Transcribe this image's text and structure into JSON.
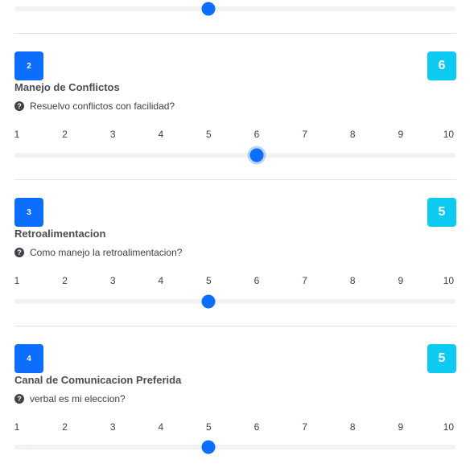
{
  "top_slider": {
    "value": 5
  },
  "questions": [
    {
      "number": "2",
      "value_badge": "6",
      "title": "Manejo de Conflictos",
      "help_text": "Resuelvo conflictos con facilidad?",
      "value": 6
    },
    {
      "number": "3",
      "value_badge": "5",
      "title": "Retroalimentacion",
      "help_text": "Como manejo la retroalimentacion?",
      "value": 5
    },
    {
      "number": "4",
      "value_badge": "5",
      "title": "Canal de Comunicacion Preferida",
      "help_text": "verbal es mi eleccion?",
      "value": 5
    }
  ],
  "scale": {
    "min": 1,
    "max": 10,
    "labels": [
      "1",
      "2",
      "3",
      "4",
      "5",
      "6",
      "7",
      "8",
      "9",
      "10"
    ]
  },
  "help_icon_glyph": "?",
  "colors": {
    "primary": "#0d6efd",
    "info": "#0dcaf0",
    "track": "#f1f2f3",
    "divider": "#e3e4e6"
  }
}
